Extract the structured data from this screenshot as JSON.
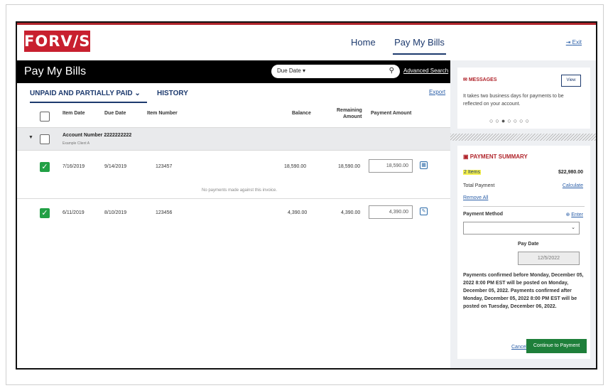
{
  "brand": {
    "logo_text": "FORV/S",
    "accent": "#c8202f"
  },
  "nav": {
    "home": "Home",
    "pay": "Pay My Bills",
    "exit": "Exit"
  },
  "titlebar": {
    "title": "Pay My Bills",
    "search_filter": "Due Date ▾",
    "search_placeholder": "",
    "advanced_search": "Advanced Search"
  },
  "tabs": {
    "unpaid": "UNPAID AND PARTIALLY PAID ⌄",
    "history": "HISTORY",
    "export": "Export"
  },
  "columns": {
    "item_date": "Item Date",
    "due_date": "Due Date",
    "item_number": "Item Number",
    "balance": "Balance",
    "remaining_1": "Remaining",
    "remaining_2": "Amount",
    "payment_amount": "Payment Amount"
  },
  "group": {
    "account": "Account Number 2222222222",
    "client": "Example Client A"
  },
  "rows": [
    {
      "item_date": "7/16/2019",
      "due_date": "9/14/2019",
      "item_number": "123457",
      "balance": "18,590.00",
      "remaining": "18,590.00",
      "payment": "18,590.00",
      "checked": true
    },
    {
      "item_date": "6/11/2019",
      "due_date": "8/10/2019",
      "item_number": "123456",
      "balance": "4,390.00",
      "remaining": "4,390.00",
      "payment": "4,390.00",
      "checked": true
    }
  ],
  "no_payments_text": "No payments made against this invoice.",
  "messages": {
    "title": "MESSAGES",
    "view": "View",
    "body": "It takes two business days for payments to be reflected on your account.",
    "dots": "○○●○○○○"
  },
  "summary": {
    "title": "PAYMENT SUMMARY",
    "items": "2 Items",
    "total": "$22,980.00",
    "total_payment_label": "Total Payment",
    "calculate": "Calculate",
    "remove_all": "Remove All",
    "payment_method_label": "Payment Method",
    "enter": "Enter",
    "pay_date_label": "Pay Date",
    "pay_date_value": "12/5/2022",
    "notice": "Payments confirmed before Monday, December 05, 2022 8:00 PM EST will be posted on Monday, December 05, 2022. Payments confirmed after Monday, December 05, 2022 8:00 PM EST will be posted on Tuesday, December 06, 2022.",
    "cancel": "Cancel",
    "continue": "Continue to Payment"
  },
  "colors": {
    "navy": "#1d3a6e",
    "green": "#1e7f3a",
    "red": "#b0242b",
    "link": "#2b5fa8"
  }
}
